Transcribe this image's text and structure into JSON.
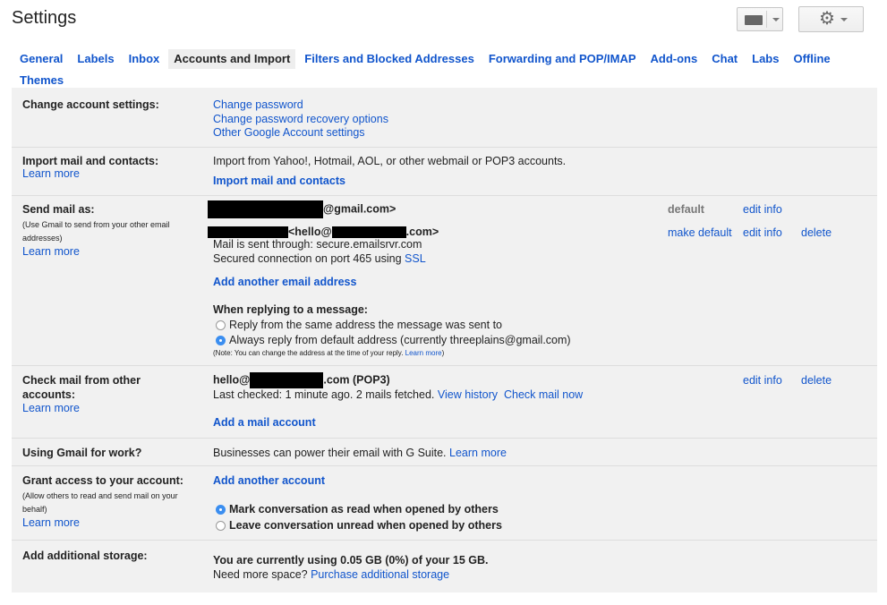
{
  "header": {
    "title": "Settings",
    "keyboard_icon": "keyboard-icon",
    "settings_icon": "gear-icon"
  },
  "tabs": [
    "General",
    "Labels",
    "Inbox",
    "Accounts and Import",
    "Filters and Blocked Addresses",
    "Forwarding and POP/IMAP",
    "Add-ons",
    "Chat",
    "Labs",
    "Offline",
    "Themes"
  ],
  "change_account": {
    "label": "Change account settings:",
    "links": [
      "Change password",
      "Change password recovery options",
      "Other Google Account settings"
    ]
  },
  "import": {
    "label": "Import mail and contacts:",
    "learn_more": "Learn more",
    "description": "Import from Yahoo!, Hotmail, AOL, or other webmail or POP3 accounts.",
    "action": "Import mail and contacts"
  },
  "send_as": {
    "label": "Send mail as:",
    "note": "(Use Gmail to send from your other email addresses)",
    "learn_more": "Learn more",
    "addr1_suffix": "@gmail.com>",
    "default_text": "default",
    "edit_info": "edit info",
    "addr2_mid": "<hello@",
    "addr2_suffix": ".com>",
    "sent_through": "Mail is sent through: secure.emailsrvr.com",
    "secured": "Secured connection on port 465 using ",
    "ssl": "SSL",
    "make_default": "make default",
    "delete": "delete",
    "add_another": "Add another email address",
    "reply_heading": "When replying to a message:",
    "reply_same": "Reply from the same address the message was sent to",
    "reply_default": "Always reply from default address (currently threeplains@gmail.com)",
    "reply_note": "(Note: You can change the address at the time of your reply. ",
    "reply_note_link": "Learn more",
    "reply_note_end": ")"
  },
  "check_mail": {
    "label": "Check mail from other accounts:",
    "learn_more": "Learn more",
    "addr_prefix": "hello@",
    "addr_suffix": ".com (POP3)",
    "last_checked": "Last checked: 1 minute ago. 2 mails fetched.",
    "view_history": "View history",
    "check_now": "Check mail now",
    "edit_info": "edit info",
    "delete": "delete",
    "add_account": "Add a mail account"
  },
  "work": {
    "label": "Using Gmail for work?",
    "text": "Businesses can power their email with G Suite. ",
    "learn_more": "Learn more"
  },
  "grant": {
    "label": "Grant access to your account:",
    "note": "(Allow others to read and send mail on your behalf)",
    "learn_more": "Learn more",
    "add_another": "Add another account",
    "opt_read": "Mark conversation as read when opened by others",
    "opt_unread": "Leave conversation unread when opened by others"
  },
  "storage": {
    "label": "Add additional storage:",
    "usage": "You are currently using 0.05 GB (0%) of your 15 GB.",
    "need_more": "Need more space? ",
    "purchase": "Purchase additional storage"
  }
}
